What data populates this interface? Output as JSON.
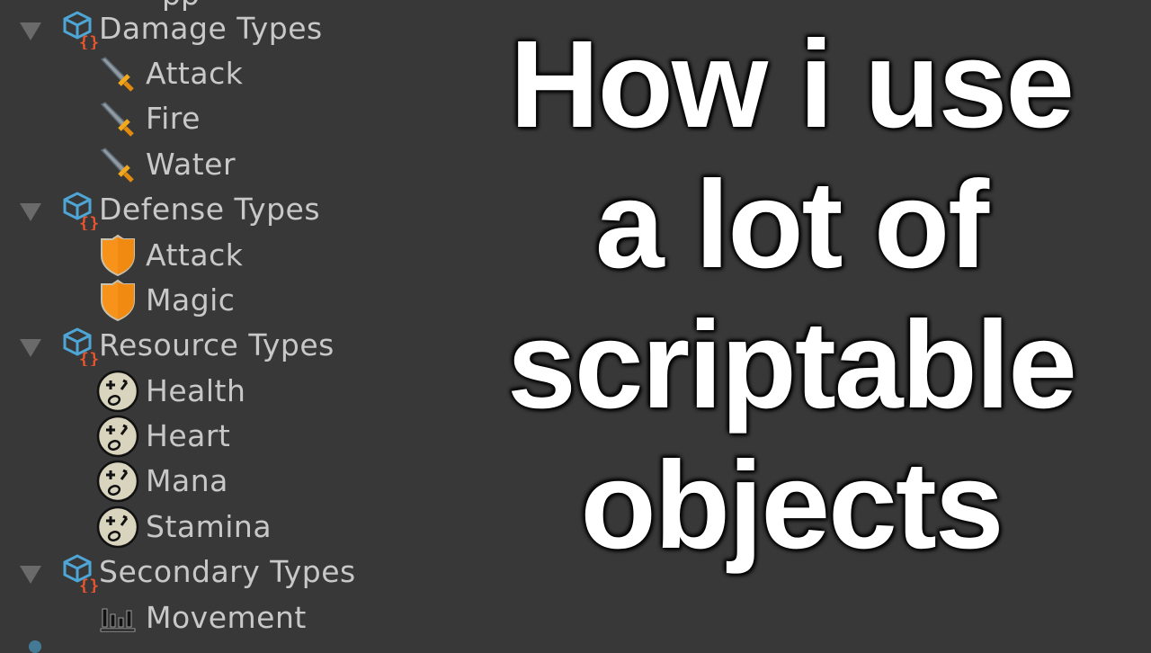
{
  "hierarchy": {
    "groups": [
      {
        "label": "Damage Types",
        "icon": "scriptable-object-script-icon",
        "expanded": true,
        "children": [
          {
            "label": "Attack",
            "icon": "sword-icon"
          },
          {
            "label": "Fire",
            "icon": "sword-icon"
          },
          {
            "label": "Water",
            "icon": "sword-icon"
          }
        ]
      },
      {
        "label": "Defense Types",
        "icon": "scriptable-object-script-icon",
        "expanded": true,
        "children": [
          {
            "label": "Attack",
            "icon": "shield-icon"
          },
          {
            "label": "Magic",
            "icon": "shield-icon"
          }
        ]
      },
      {
        "label": "Resource Types",
        "icon": "scriptable-object-script-icon",
        "expanded": true,
        "children": [
          {
            "label": "Health",
            "icon": "face-icon"
          },
          {
            "label": "Heart",
            "icon": "face-icon"
          },
          {
            "label": "Mana",
            "icon": "face-icon"
          },
          {
            "label": "Stamina",
            "icon": "face-icon"
          }
        ]
      },
      {
        "label": "Secondary Types",
        "icon": "scriptable-object-script-icon",
        "expanded": true,
        "children": [
          {
            "label": "Movement",
            "icon": "bar-chart-icon"
          }
        ]
      }
    ]
  },
  "headline": {
    "lines": [
      "How i use",
      "a lot of",
      "scriptable",
      "objects"
    ]
  },
  "colors": {
    "background": "#383838",
    "tree_text": "#c8c8c8",
    "cube_blue": "#4ea6d6",
    "braces_orange": "#e8552f",
    "shield_orange": "#f7931a",
    "sword_gold": "#f2a81d",
    "face_beige": "#d9d4bd"
  }
}
